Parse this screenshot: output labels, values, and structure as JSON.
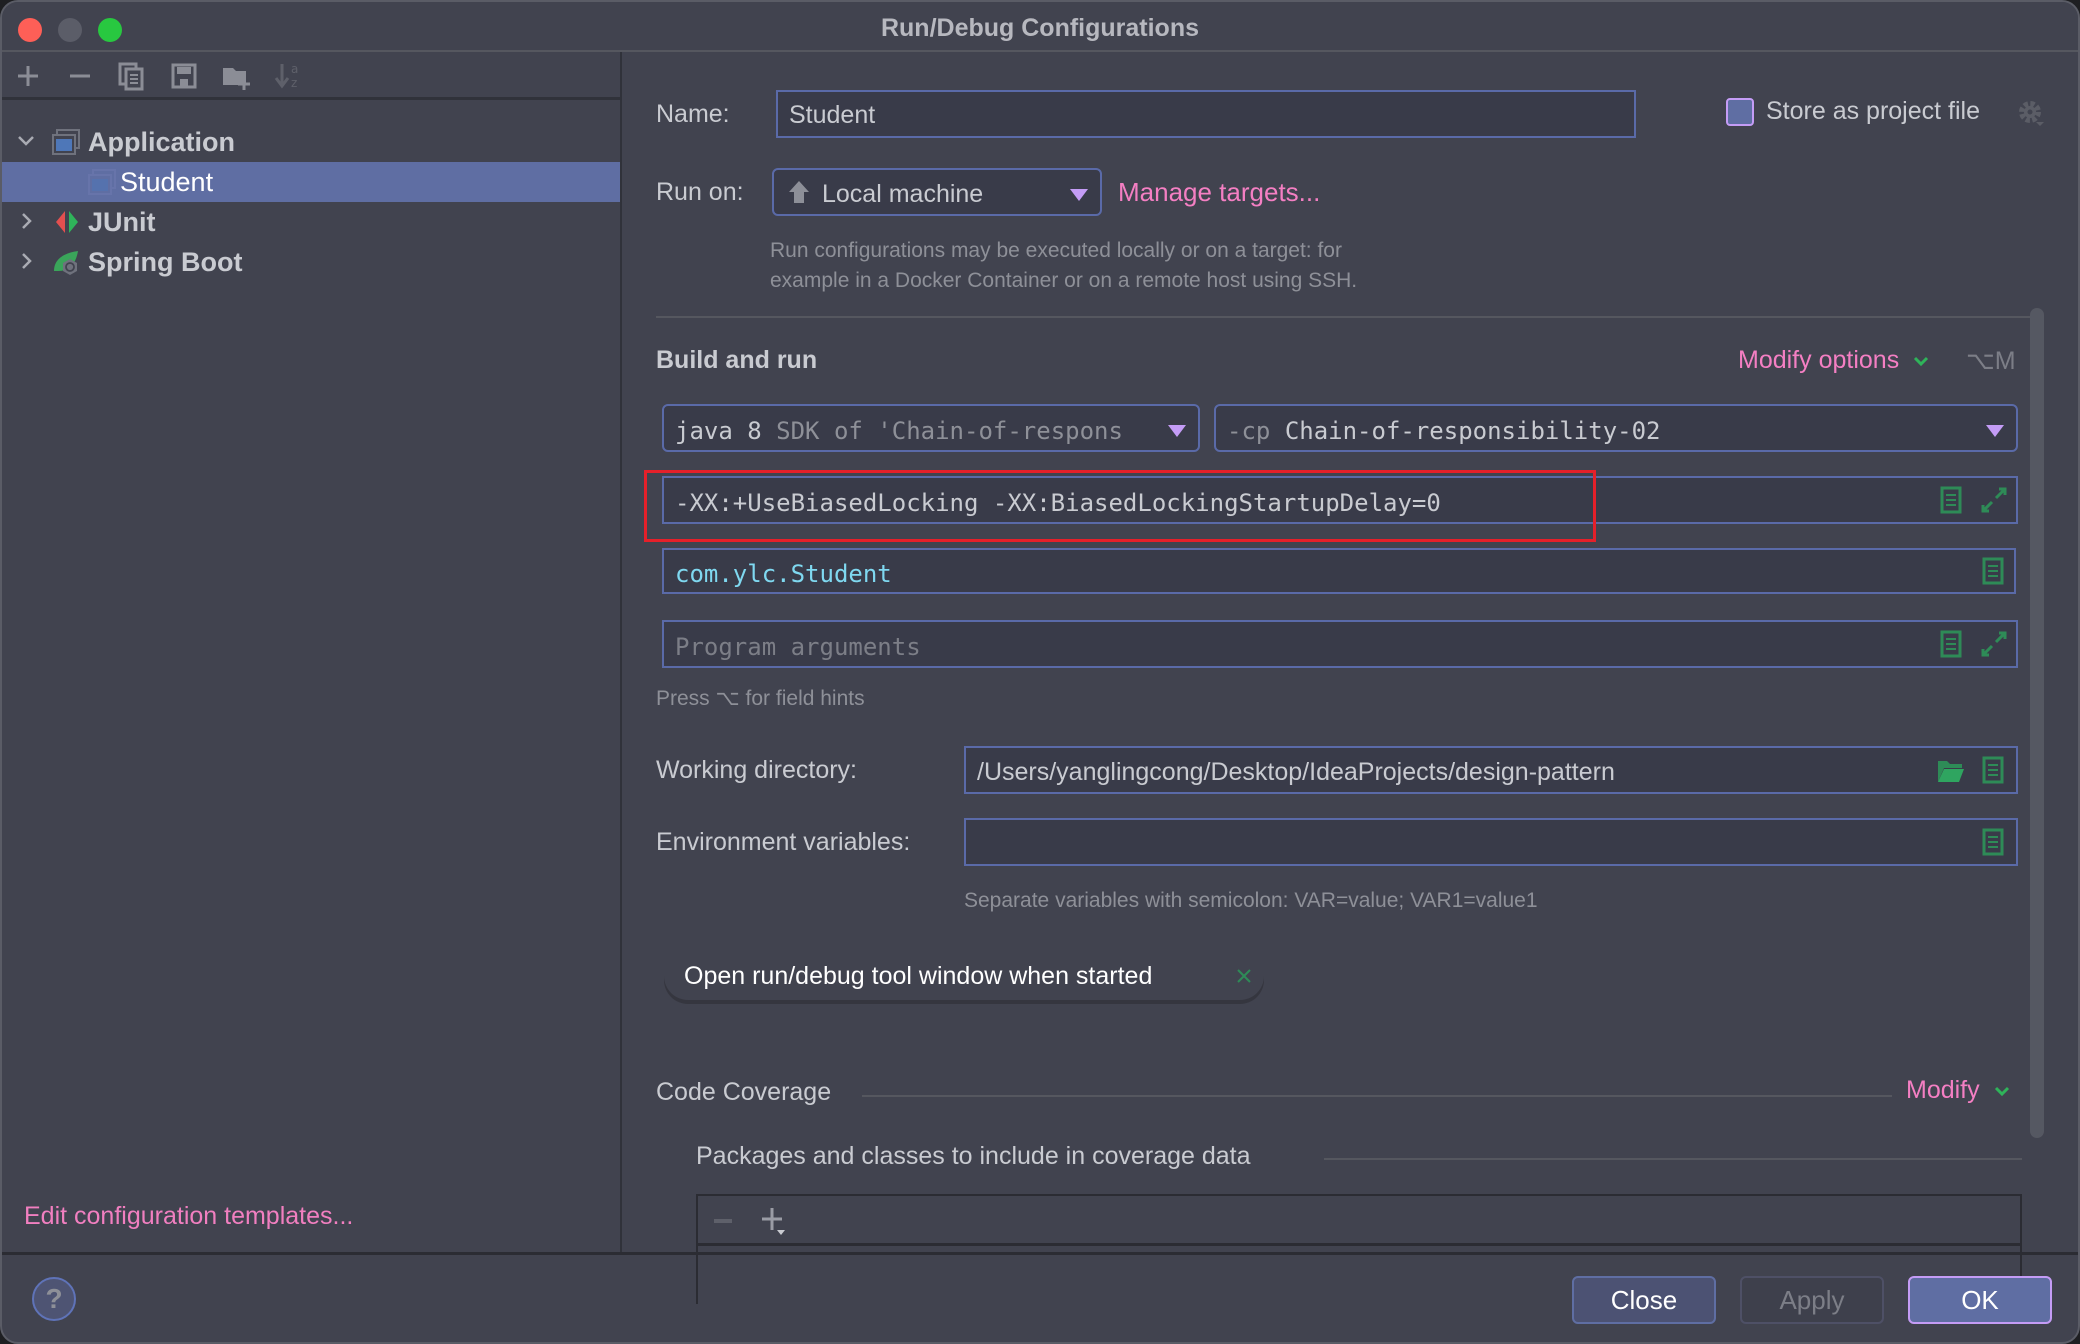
{
  "window": {
    "title": "Run/Debug Configurations"
  },
  "sidebar": {
    "toolbar": [
      {
        "icon": "add-icon",
        "glyph": "+"
      },
      {
        "icon": "remove-icon",
        "glyph": "−"
      },
      {
        "icon": "copy-icon",
        "glyph": ""
      },
      {
        "icon": "save-icon",
        "glyph": ""
      },
      {
        "icon": "new-folder-icon",
        "glyph": ""
      },
      {
        "icon": "sort-alphabetically-icon",
        "glyph": ""
      }
    ],
    "tree": [
      {
        "label": "Application",
        "expanded": true,
        "icon": "application-icon"
      },
      {
        "label": "Student",
        "selected": true,
        "icon": "application-icon"
      },
      {
        "label": "JUnit",
        "expanded": false,
        "icon": "junit-icon"
      },
      {
        "label": "Spring Boot",
        "expanded": false,
        "icon": "spring-boot-icon"
      }
    ],
    "edit_templates_link": "Edit configuration templates..."
  },
  "form": {
    "name_label": "Name:",
    "name_value": "Student",
    "store_as_project_file": {
      "label": "Store as project file",
      "checked": false
    },
    "run_on_label": "Run on:",
    "run_on_value": "Local machine",
    "manage_targets_link": "Manage targets...",
    "run_on_hint_line1": "Run configurations may be executed locally or on a target: for",
    "run_on_hint_line2": "example in a Docker Container or on a remote host using SSH.",
    "build_and_run": {
      "title": "Build and run",
      "modify_options_link": "Modify options",
      "modify_options_shortcut": "⌥M",
      "jre_value_main": "java 8",
      "jre_value_detail": "SDK of 'Chain-of-respons",
      "classpath_prefix": "-cp",
      "classpath_value": "Chain-of-responsibility-02",
      "vm_options_value": "-XX:+UseBiasedLocking -XX:BiasedLockingStartupDelay=0",
      "main_class_value": "com.ylc.Student",
      "program_args_placeholder": "Program arguments",
      "field_hints": "Press ⌥ for field hints"
    },
    "working_directory_label": "Working directory:",
    "working_directory_value": "/Users/yanglingcong/Desktop/IdeaProjects/design-pattern",
    "env_vars_label": "Environment variables:",
    "env_vars_value": "",
    "env_vars_hint": "Separate variables with semicolon: VAR=value; VAR1=value1",
    "option_chip": "Open run/debug tool window when started",
    "code_coverage": {
      "title": "Code Coverage",
      "modify_link": "Modify",
      "packages_title": "Packages and classes to include in coverage data"
    }
  },
  "footer": {
    "help_label": "?",
    "close_label": "Close",
    "apply_label": "Apply",
    "ok_label": "OK"
  },
  "colors": {
    "accent_link": "#f47fc3",
    "selection": "#5f6ea3",
    "icon_green": "#2e8b57",
    "highlight_box": "#e5202a"
  }
}
